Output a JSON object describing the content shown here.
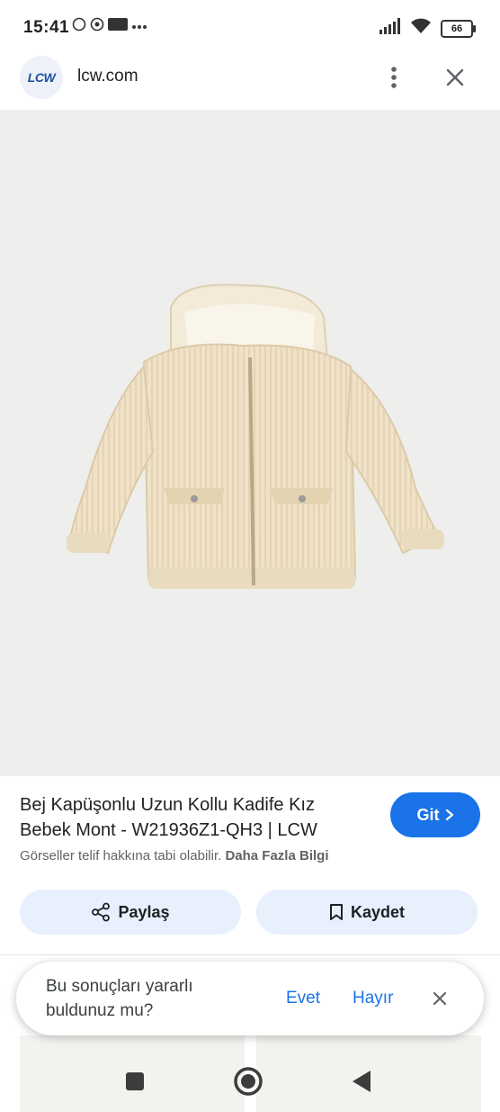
{
  "status_bar": {
    "time": "15:41",
    "notification_icons": [
      "whatsapp-icon",
      "chrome-icon",
      "hb-icon",
      "ge-icon",
      "more-dots"
    ],
    "battery": "66"
  },
  "browser": {
    "site_logo_text": "LCW",
    "site_name": "lcw.com"
  },
  "product": {
    "title": "Bej Kapüşonlu Uzun Kollu Kadife Kız Bebek Mont - W21936Z1-QH3 | LCW",
    "go_label": "Git",
    "copyright_text": "Görseller telif hakkına tabi olabilir.",
    "more_info_label": "Daha Fazla Bilgi",
    "share_label": "Paylaş",
    "save_label": "Kaydet"
  },
  "feedback": {
    "question": "Bu sonuçları yararlı buldunuz mu?",
    "yes_label": "Evet",
    "no_label": "Hayır"
  },
  "colors": {
    "accent": "#1a73e8",
    "button_bg": "#e8f0fe",
    "image_bg": "#eeeeec",
    "jacket": "#efe2c8"
  }
}
